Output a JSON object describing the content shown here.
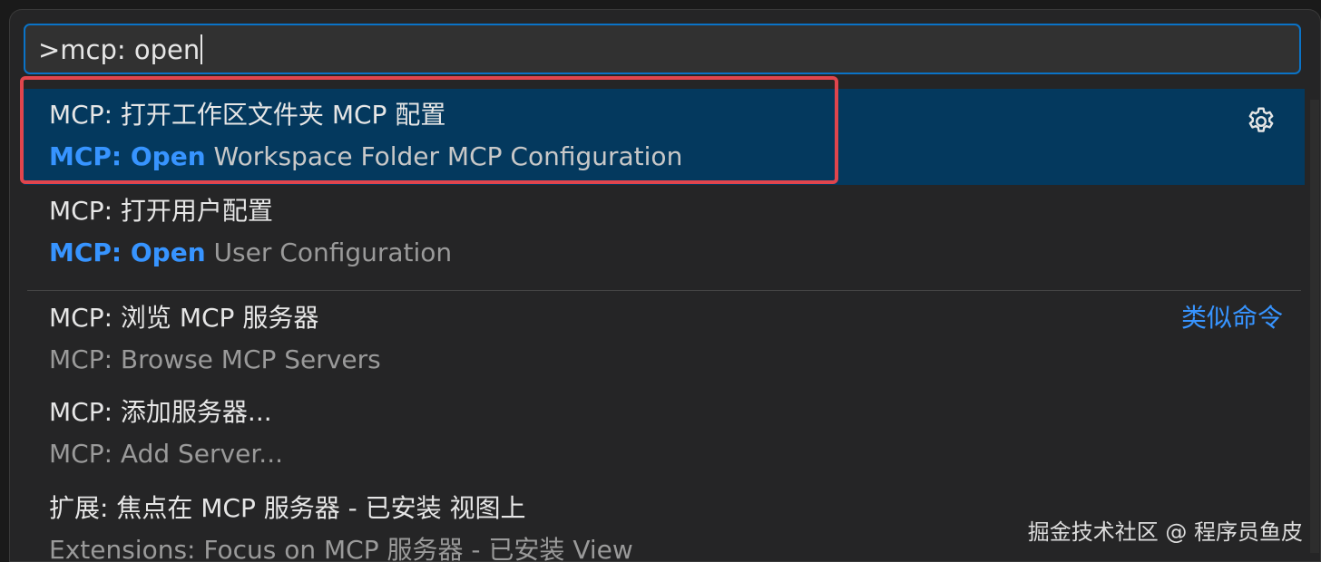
{
  "input": {
    "value": ">mcp: open"
  },
  "items": [
    {
      "label": "MCP: 打开工作区文件夹 MCP 配置",
      "detail_match": "MCP: Open",
      "detail_rest": " Workspace Folder MCP Configuration",
      "icon": "gear-icon",
      "selected": true
    },
    {
      "label": "MCP: 打开用户配置",
      "detail_match": "MCP: Open",
      "detail_rest": " User Configuration"
    },
    {
      "label": "MCP: 浏览 MCP 服务器",
      "detail": "MCP: Browse MCP Servers",
      "tag": "类似命令"
    },
    {
      "label": "MCP: 添加服务器...",
      "detail": "MCP: Add Server..."
    },
    {
      "label": "扩展: 焦点在 MCP 服务器 - 已安装 视图上",
      "detail": "Extensions: Focus on MCP 服务器 - 已安装 View"
    }
  ],
  "watermark": "掘金技术社区 @ 程序员鱼皮",
  "colors": {
    "accent": "#3794ff",
    "selection": "#04395e",
    "highlight_box": "#e0454d"
  }
}
